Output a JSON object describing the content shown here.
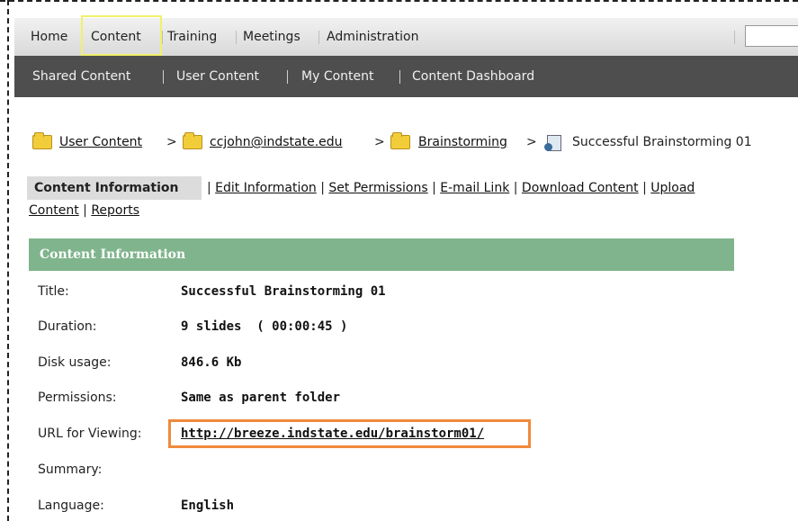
{
  "top_nav": {
    "items": [
      "Home",
      "Content",
      "Training",
      "Meetings",
      "Administration"
    ],
    "search_placeholder": ""
  },
  "sub_nav": {
    "items": [
      "Shared Content",
      "User Content",
      "My Content",
      "Content Dashboard"
    ]
  },
  "breadcrumb": {
    "items": [
      "User Content",
      "ccjohn@indstate.edu",
      "Brainstorming"
    ],
    "current": "Successful Brainstorming 01",
    "separator": ">"
  },
  "actions": {
    "active": "Content Information",
    "links": [
      "Edit Information",
      "Set Permissions",
      "E-mail Link",
      "Download Content",
      "Upload Content",
      "Reports"
    ],
    "upload_line1": "Upload",
    "upload_line2": "Content"
  },
  "info": {
    "header": "Content Information",
    "rows": [
      {
        "label": "Title:",
        "value": "Successful Brainstorming 01"
      },
      {
        "label": "Duration:",
        "value": "9 slides  ( 00:00:45 )"
      },
      {
        "label": "Disk usage:",
        "value": "846.6 Kb"
      },
      {
        "label": "Permissions:",
        "value": "Same as parent folder"
      },
      {
        "label": "URL for Viewing:",
        "value": "http://breeze.indstate.edu/brainstorm01/"
      },
      {
        "label": "Summary:",
        "value": ""
      },
      {
        "label": "Language:",
        "value": "English"
      }
    ]
  },
  "colors": {
    "nav_dark": "#4e4e4e",
    "info_header": "#7fb48c",
    "highlight_url": "#f08a3c",
    "highlight_tab": "#f1f06a"
  }
}
